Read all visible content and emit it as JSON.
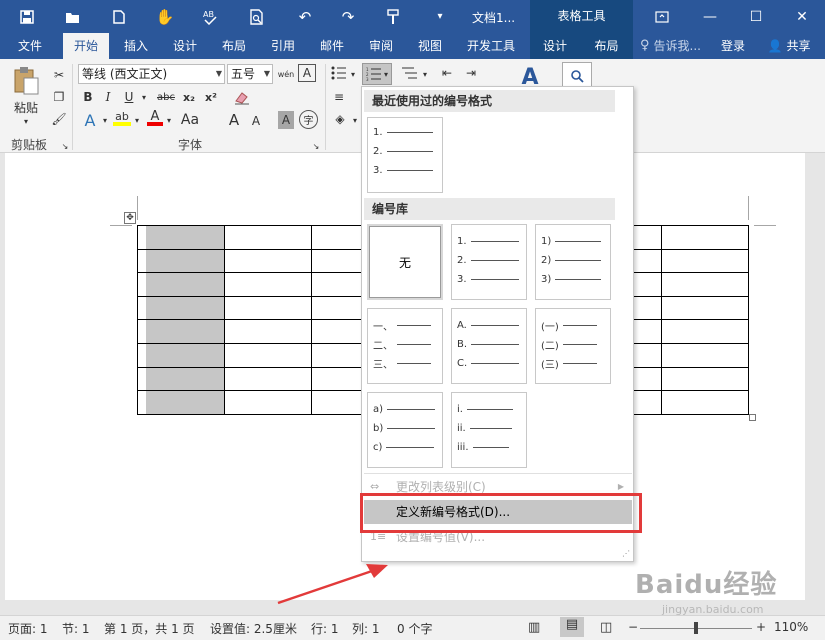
{
  "titlebar": {
    "doc_title": "文档1...",
    "context_tab_group": "表格工具",
    "quick_access_icons": [
      "save-icon",
      "open-folder-icon",
      "new-document-icon",
      "touch-mode-icon",
      "spelling-icon",
      "print-preview-icon",
      "undo-icon",
      "redo-icon",
      "format-painter-icon",
      "customize-qat-icon"
    ],
    "window_buttons": [
      "ribbon-display-options-icon",
      "minimize-icon",
      "maximize-icon",
      "close-icon"
    ]
  },
  "tabs": {
    "items": [
      "文件",
      "开始",
      "插入",
      "设计",
      "布局",
      "引用",
      "邮件",
      "审阅",
      "视图",
      "开发工具",
      "设计",
      "布局"
    ],
    "active": "开始",
    "tell_me": "告诉我...",
    "login": "登录",
    "share": "共享"
  },
  "ribbon": {
    "clipboard": {
      "paste": "粘贴",
      "group_label": "剪贴板"
    },
    "font": {
      "font_name": "等线 (西文正文)",
      "font_size": "五号",
      "group_label": "字体",
      "bold": "B",
      "italic": "I",
      "underline": "U",
      "strikethrough": "abc",
      "subscript": "x₂",
      "superscript": "x²",
      "phonetic": "wén",
      "char_border": "A",
      "grow": "A",
      "shrink": "A",
      "shading": "A",
      "enclose": "字",
      "text_effects": "A",
      "highlight": "ab",
      "font_color": "A"
    }
  },
  "dropdown": {
    "recent_header": "最近使用过的编号格式",
    "library_header": "编号库",
    "none_label": "无",
    "recent_tile": [
      "1.",
      "2.",
      "3."
    ],
    "tiles": [
      [
        "1.",
        "2.",
        "3."
      ],
      [
        "1)",
        "2)",
        "3)"
      ],
      [
        "一、",
        "二、",
        "三、"
      ],
      [
        "A.",
        "B.",
        "C."
      ],
      [
        "(一)",
        "(二)",
        "(三)"
      ],
      [
        "a)",
        "b)",
        "c)"
      ],
      [
        "i.",
        "ii.",
        "iii."
      ]
    ],
    "menu": {
      "change_level": "更改列表级别(C)",
      "define_new": "定义新编号格式(D)...",
      "set_value": "设置编号值(V)..."
    }
  },
  "statusbar": {
    "page": "页面: 1",
    "section": "节: 1",
    "page_of": "第 1 页，共 1 页",
    "position": "设置值: 2.5厘米",
    "line": "行: 1",
    "column": "列: 1",
    "words": "0 个字",
    "zoom": "110%"
  },
  "watermark": {
    "text": "Baidu经验",
    "sub": "jingyan.baidu.com"
  },
  "colors": {
    "accent": "#2b579a",
    "context_tab": "#17497f",
    "annotation": "#e23a3a"
  }
}
